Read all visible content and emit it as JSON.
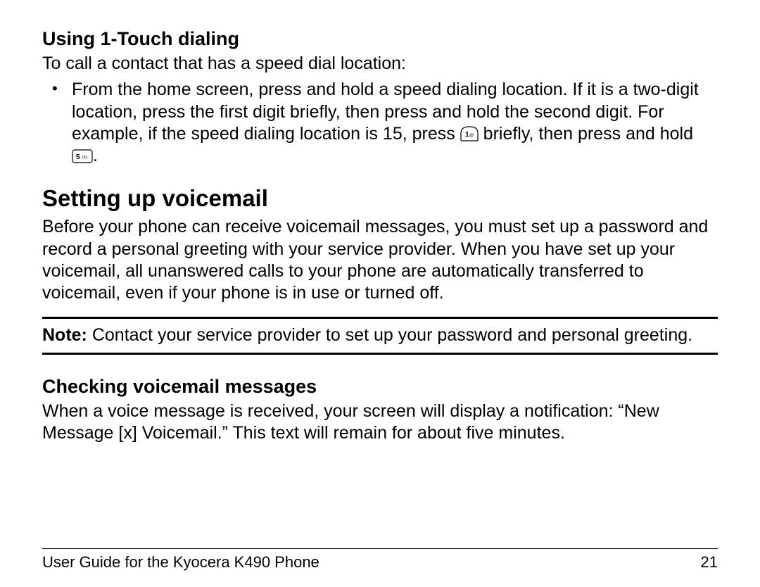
{
  "section1": {
    "heading": "Using 1-Touch dialing",
    "intro": "To call a contact that has a speed dial location:",
    "bullet_part1": "From the home screen, press and hold a speed dialing location. If it is a two-digit location, press the first digit briefly, then press and hold the second digit. For example, if the speed dialing location is 15, press ",
    "bullet_part2": " briefly, then press and hold ",
    "bullet_part3": ".",
    "icon1_name": "key-1-icon",
    "icon2_name": "key-5-icon"
  },
  "section2": {
    "heading": "Setting up voicemail",
    "para": "Before your phone can receive voicemail messages, you must set up a password and record a personal greeting with your service provider. When you have set up your voicemail, all unanswered calls to your phone are automatically transferred to voicemail, even if your phone is in use or turned off."
  },
  "note": {
    "label": "Note:",
    "text": " Contact your service provider to set up your password and personal greeting."
  },
  "section3": {
    "heading": "Checking voicemail messages",
    "para": "When a voice message is received, your screen will display a notification: “New Message [x] Voicemail.” This text will remain for about five minutes."
  },
  "footer": {
    "left": "User Guide for the Kyocera K490 Phone",
    "right": "21"
  }
}
